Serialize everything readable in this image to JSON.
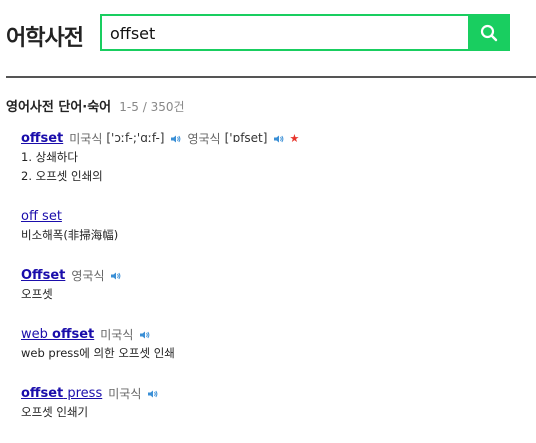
{
  "header": {
    "logo": "어학사전",
    "search": {
      "value": "offset"
    }
  },
  "section": {
    "name": "영어사전 단어·숙어",
    "count": "1-5 / 350건"
  },
  "entries": [
    {
      "word_bold": "offset",
      "word_rest": "",
      "pron1_region": "미국식",
      "pron1": "['ɔːf-;'ɑːf-]",
      "pron2_region": "영국식",
      "pron2": "['ɒfset]",
      "star": "★",
      "meanings": [
        "1. 상쇄하다",
        "2. 오프셋 인쇄의"
      ]
    },
    {
      "word_plain": "off set",
      "meanings": [
        "비소해폭(非掃海幅)"
      ]
    },
    {
      "word_bold": "Offset",
      "region": "영국식",
      "meanings": [
        "오프셋"
      ]
    },
    {
      "word_pre": "web ",
      "word_bold": "offset",
      "region": "미국식",
      "meanings": [
        "web press에 의한 오프셋 인쇄"
      ]
    },
    {
      "word_bold": "offset",
      "word_post": " press",
      "region": "미국식",
      "meanings": [
        "오프셋 인쇄기"
      ]
    }
  ],
  "colors": {
    "accent": "#19ce60",
    "link": "#1a0dab",
    "star": "#e8342b",
    "speaker": "#3a8fd6"
  },
  "icons": {
    "search": "search-icon",
    "speaker": "speaker-icon",
    "star": "star-icon"
  }
}
